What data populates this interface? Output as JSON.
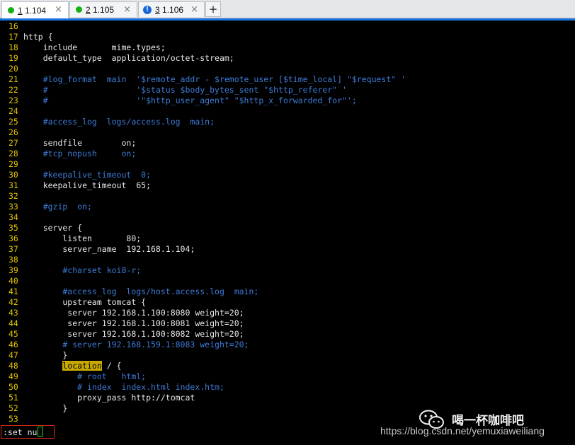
{
  "tabs": [
    {
      "number": "1",
      "title": "1.104",
      "status": "connected",
      "active": true
    },
    {
      "number": "2",
      "title": "1.105",
      "status": "connected",
      "active": false
    },
    {
      "number": "3",
      "title": "1.106",
      "status": "warning",
      "active": false
    }
  ],
  "tab_close_glyph": "×",
  "tab_add_glyph": "+",
  "warning_glyph": "!",
  "colors": {
    "accent": "#1c74e0",
    "line_number": "#e0c400",
    "text": "#e8e8e8",
    "comment": "#3d7bd6",
    "highlight": "#c9a800",
    "connected": "#13b213",
    "warning": "#1668d8"
  },
  "editor": {
    "lines": [
      {
        "n": "16",
        "t": "",
        "c": "white"
      },
      {
        "n": "17",
        "t": "http {",
        "c": "white"
      },
      {
        "n": "18",
        "t": "    include       mime.types;",
        "c": "white"
      },
      {
        "n": "19",
        "t": "    default_type  application/octet-stream;",
        "c": "white"
      },
      {
        "n": "20",
        "t": "",
        "c": "white"
      },
      {
        "n": "21",
        "t": "    #log_format  main  '$remote_addr - $remote_user [$time_local] \"$request\" '",
        "c": "blue"
      },
      {
        "n": "22",
        "t": "    #                  '$status $body_bytes_sent \"$http_referer\" '",
        "c": "blue"
      },
      {
        "n": "23",
        "t": "    #                  '\"$http_user_agent\" \"$http_x_forwarded_for\"';",
        "c": "blue"
      },
      {
        "n": "24",
        "t": "",
        "c": "white"
      },
      {
        "n": "25",
        "t": "    #access_log  logs/access.log  main;",
        "c": "blue"
      },
      {
        "n": "26",
        "t": "",
        "c": "white"
      },
      {
        "n": "27",
        "t": "    sendfile        on;",
        "c": "white"
      },
      {
        "n": "28",
        "t": "    #tcp_nopush     on;",
        "c": "blue"
      },
      {
        "n": "29",
        "t": "",
        "c": "white"
      },
      {
        "n": "30",
        "t": "    #keepalive_timeout  0;",
        "c": "blue"
      },
      {
        "n": "31",
        "t": "    keepalive_timeout  65;",
        "c": "white"
      },
      {
        "n": "32",
        "t": "",
        "c": "white"
      },
      {
        "n": "33",
        "t": "    #gzip  on;",
        "c": "blue"
      },
      {
        "n": "34",
        "t": "",
        "c": "white"
      },
      {
        "n": "35",
        "t": "    server {",
        "c": "white"
      },
      {
        "n": "36",
        "t": "        listen       80;",
        "c": "white"
      },
      {
        "n": "37",
        "t": "        server_name  192.168.1.104;",
        "c": "white"
      },
      {
        "n": "38",
        "t": "",
        "c": "white"
      },
      {
        "n": "39",
        "t": "        #charset koi8-r;",
        "c": "blue"
      },
      {
        "n": "40",
        "t": "",
        "c": "white"
      },
      {
        "n": "41",
        "t": "        #access_log  logs/host.access.log  main;",
        "c": "blue"
      },
      {
        "n": "42",
        "t": "        upstream tomcat {",
        "c": "white"
      },
      {
        "n": "43",
        "t": "         server 192.168.1.100:8080 weight=20;",
        "c": "white"
      },
      {
        "n": "44",
        "t": "         server 192.168.1.100:8081 weight=20;",
        "c": "white"
      },
      {
        "n": "45",
        "t": "         server 192.168.1.100:8082 weight=20;",
        "c": "white"
      },
      {
        "n": "46",
        "t": "        # server 192.168.159.1:8083 weight=20;",
        "c": "blue"
      },
      {
        "n": "47",
        "t": "        }",
        "c": "white"
      },
      {
        "n": "48",
        "t": "        location / {",
        "c": "white",
        "hl": "location"
      },
      {
        "n": "49",
        "t": "           # root   html;",
        "c": "blue"
      },
      {
        "n": "50",
        "t": "           # index  index.html index.htm;",
        "c": "blue"
      },
      {
        "n": "51",
        "t": "           proxy_pass http://tomcat",
        "c": "white"
      },
      {
        "n": "52",
        "t": "        }",
        "c": "white"
      },
      {
        "n": "53",
        "t": "",
        "c": "white"
      }
    ]
  },
  "command_line": ":set nu",
  "watermark": {
    "name": "喝一杯咖啡吧",
    "url": "https://blog.csdn.net/yemuxiaweiliang",
    "icon": "wechat-icon"
  }
}
